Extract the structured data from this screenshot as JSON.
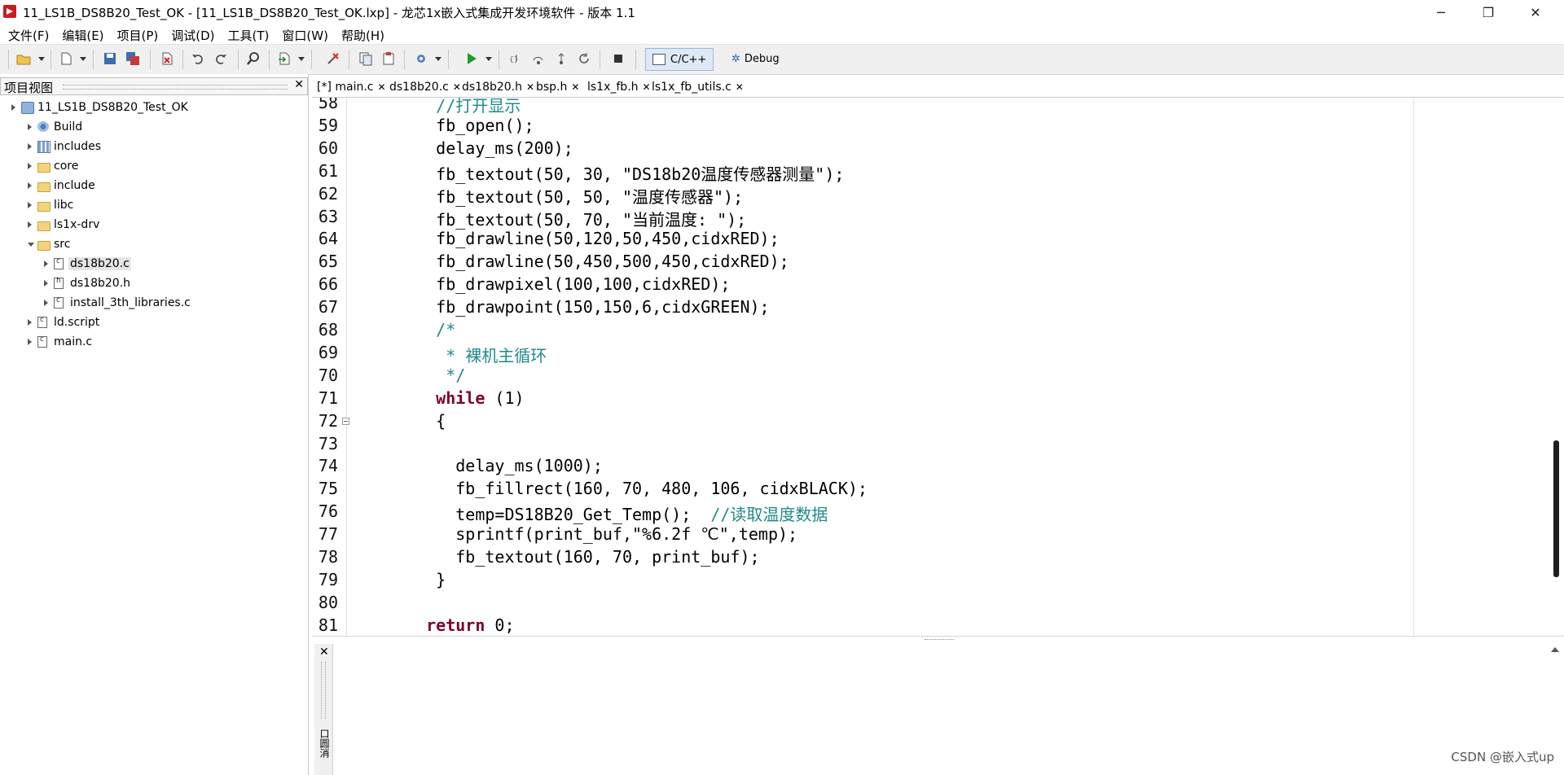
{
  "window": {
    "title": "11_LS1B_DS8B20_Test_OK - [11_LS1B_DS8B20_Test_OK.lxp] - 龙芯1x嵌入式集成开发环境软件 - 版本 1.1",
    "minimize": "─",
    "maximize": "❐",
    "close": "✕"
  },
  "menu": [
    "文件(F)",
    "编辑(E)",
    "项目(P)",
    "调试(D)",
    "工具(T)",
    "窗口(W)",
    "帮助(H)"
  ],
  "toolbar": {
    "perspective_cpp": "C/C++",
    "perspective_debug": "Debug"
  },
  "project_panel": {
    "title": "项目视图",
    "close": "✕",
    "tree": [
      {
        "label": "11_LS1B_DS8B20_Test_OK",
        "icon": "project-icon",
        "state": "closed"
      },
      {
        "label": "Build",
        "icon": "build-icon",
        "state": "closed"
      },
      {
        "label": "includes",
        "icon": "includes-icon",
        "state": "closed"
      },
      {
        "label": "core",
        "icon": "folder-icon",
        "state": "closed"
      },
      {
        "label": "include",
        "icon": "folder-icon",
        "state": "closed"
      },
      {
        "label": "libc",
        "icon": "folder-icon",
        "state": "closed"
      },
      {
        "label": "ls1x-drv",
        "icon": "folder-icon",
        "state": "closed"
      },
      {
        "label": "src",
        "icon": "folder-icon",
        "state": "open"
      },
      {
        "label": "ds18b20.c",
        "icon": "c-file-icon",
        "state": "closed",
        "selected": true
      },
      {
        "label": "ds18b20.h",
        "icon": "h-file-icon",
        "state": "closed"
      },
      {
        "label": "install_3th_libraries.c",
        "icon": "c-file-icon",
        "state": "closed"
      },
      {
        "label": "ld.script",
        "icon": "file-icon",
        "state": "closed"
      },
      {
        "label": "main.c",
        "icon": "c-file-icon",
        "state": "closed"
      }
    ]
  },
  "editor_tabs": [
    {
      "label": "[*] main.c",
      "active": true
    },
    {
      "label": "ds18b20.c"
    },
    {
      "label": "ds18b20.h"
    },
    {
      "label": "bsp.h"
    },
    {
      "label": "ls1x_fb.h"
    },
    {
      "label": "ls1x_fb_utils.c"
    }
  ],
  "tab_close": "✕",
  "code_lines": [
    {
      "n": "58",
      "pre": "    ",
      "text": "//打开显示",
      "kind": "comment"
    },
    {
      "n": "59",
      "pre": "    ",
      "text": "fb_open();",
      "kind": "plain"
    },
    {
      "n": "60",
      "pre": "    ",
      "text": "delay_ms(200);",
      "kind": "plain"
    },
    {
      "n": "61",
      "pre": "    ",
      "text": "fb_textout(50, 30, \"DS18b20温度传感器测量\");",
      "kind": "plain"
    },
    {
      "n": "62",
      "pre": "    ",
      "text": "fb_textout(50, 50, \"温度传感器\");",
      "kind": "plain"
    },
    {
      "n": "63",
      "pre": "    ",
      "text": "fb_textout(50, 70, \"当前温度: \");",
      "kind": "plain"
    },
    {
      "n": "64",
      "pre": "    ",
      "text": "fb_drawline(50,120,50,450,cidxRED);",
      "kind": "plain"
    },
    {
      "n": "65",
      "pre": "    ",
      "text": "fb_drawline(50,450,500,450,cidxRED);",
      "kind": "plain"
    },
    {
      "n": "66",
      "pre": "    ",
      "text": "fb_drawpixel(100,100,cidxRED);",
      "kind": "plain"
    },
    {
      "n": "67",
      "pre": "    ",
      "text": "fb_drawpoint(150,150,6,cidxGREEN);",
      "kind": "plain"
    },
    {
      "n": "68",
      "pre": "    ",
      "text": "/*",
      "kind": "comment"
    },
    {
      "n": "69",
      "pre": "     ",
      "text": "* 裸机主循环",
      "kind": "comment"
    },
    {
      "n": "70",
      "pre": "     ",
      "text": "*/",
      "kind": "comment"
    },
    {
      "n": "71",
      "pre": "    ",
      "text": "while",
      "rest": " (1)",
      "kind": "keyword"
    },
    {
      "n": "72",
      "pre": "    ",
      "text": "{",
      "kind": "plain",
      "fold": true
    },
    {
      "n": "73",
      "pre": "",
      "text": "",
      "kind": "plain"
    },
    {
      "n": "74",
      "pre": "      ",
      "text": "delay_ms(1000);",
      "kind": "plain"
    },
    {
      "n": "75",
      "pre": "      ",
      "text": "fb_fillrect(160, 70, 480, 106, cidxBLACK);",
      "kind": "plain"
    },
    {
      "n": "76",
      "pre": "      ",
      "text": "temp=DS18B20_Get_Temp();  ",
      "rest_comment": "//读取温度数据",
      "kind": "mixed"
    },
    {
      "n": "77",
      "pre": "      ",
      "text": "sprintf(print_buf,\"%6.2f ℃\",temp);",
      "kind": "plain"
    },
    {
      "n": "78",
      "pre": "      ",
      "text": "fb_textout(160, 70, print_buf);",
      "kind": "plain"
    },
    {
      "n": "79",
      "pre": "    ",
      "text": "}",
      "kind": "plain"
    },
    {
      "n": "80",
      "pre": "",
      "text": "",
      "kind": "plain"
    },
    {
      "n": "81",
      "pre": "   ",
      "text": "return",
      "rest": " 0;",
      "kind": "keyword"
    }
  ],
  "bottom_panel": {
    "close": "✕",
    "vertical_label": "口圆消"
  },
  "watermark": "CSDN @嵌入式up",
  "colors": {
    "comment": "#208a8a",
    "keyword": "#7f0033",
    "app_icon": "#c81e1e"
  }
}
